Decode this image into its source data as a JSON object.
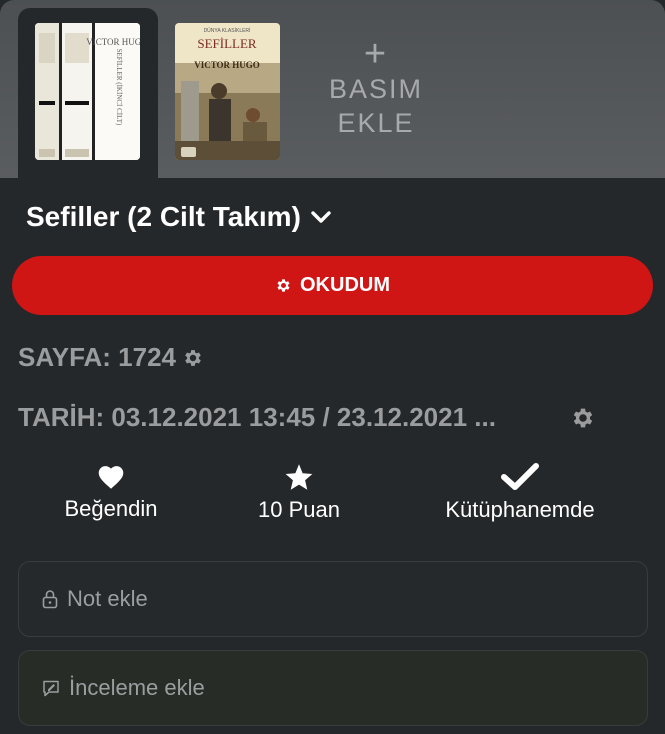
{
  "editions": {
    "covers": [
      {
        "title_lines": [
          "SEFİLLER",
          "(İKİNCİ CİLT)"
        ],
        "author": "VICTOR HUGO",
        "selected": true
      },
      {
        "series": "DÜNYA KLASİKLERİ",
        "title": "SEFİLLER",
        "author": "VICTOR HUGO",
        "selected": false
      }
    ],
    "add_plus": "+",
    "add_line1": "BASIM",
    "add_line2": "EKLE"
  },
  "book": {
    "title": "Sefiller (2 Cilt Takım)",
    "read_button": "OKUDUM",
    "pages_text": "SAYFA: 1724",
    "dates_text": "TARİH: 03.12.2021 13:45 / 23.12.2021 ..."
  },
  "actions": {
    "like": "Beğendin",
    "rating": "10 Puan",
    "library": "Kütüphanemde"
  },
  "fields": {
    "note_placeholder": "Not ekle",
    "review_placeholder": "İnceleme ekle"
  },
  "colors": {
    "accent_red": "#d01515",
    "background": "#24282b",
    "editions_strip": "#55585b"
  },
  "icons": {
    "title_dropdown": "chevron-down-icon",
    "read_button": "gear-icon",
    "pages": "gear-icon",
    "dates": "gear-icon",
    "like": "heart-icon",
    "rating": "star-icon",
    "library": "checkmark-icon",
    "note": "lock-icon",
    "review": "comment-edit-icon"
  }
}
